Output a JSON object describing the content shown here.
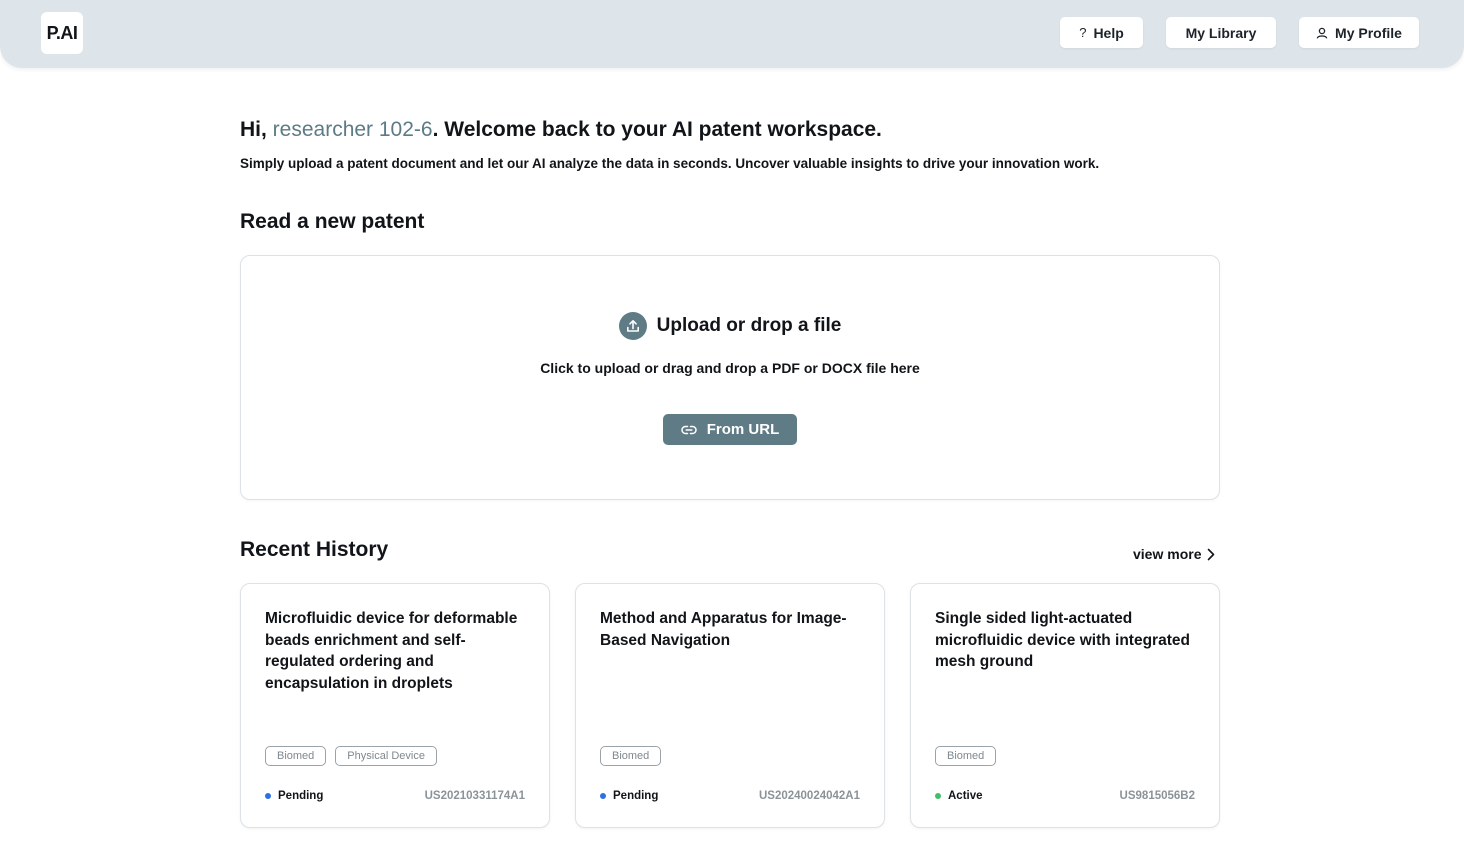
{
  "header": {
    "logo": "P.AI",
    "help_label": "Help",
    "library_label": "My Library",
    "profile_label": "My Profile"
  },
  "welcome": {
    "prefix": "Hi, ",
    "username": "researcher 102-6",
    "suffix": ". Welcome back to your AI patent workspace.",
    "subtitle": "Simply upload a patent document and let our AI analyze the data in seconds. Uncover valuable insights to drive your innovation work."
  },
  "read_section": {
    "title": "Read a new patent",
    "upload_title": "Upload or drop a file",
    "upload_desc": "Click to upload or drag and drop a PDF or DOCX file here",
    "url_button": "From URL"
  },
  "recent": {
    "title": "Recent History",
    "view_more": "view more",
    "cards": [
      {
        "title": "Microfluidic device for deformable beads enrichment and self-regulated ordering and encapsulation in droplets",
        "tags": [
          "Biomed",
          "Physical Device"
        ],
        "status": "Pending",
        "status_color": "#2f6fe0",
        "patent_number": "US20210331174A1"
      },
      {
        "title": "Method and Apparatus for Image-Based Navigation",
        "tags": [
          "Biomed"
        ],
        "status": "Pending",
        "status_color": "#2f6fe0",
        "patent_number": "US20240024042A1"
      },
      {
        "title": "Single sided light-actuated microfluidic device with integrated mesh ground",
        "tags": [
          "Biomed"
        ],
        "status": "Active",
        "status_color": "#3fbf6a",
        "patent_number": "US9815056B2"
      }
    ]
  },
  "colors": {
    "header_bg": "#dde5ea",
    "accent": "#5f7b86",
    "username": "#5d7b86"
  },
  "icons": {
    "help": "question-icon",
    "profile": "user-icon",
    "upload": "upload-icon",
    "url": "link-icon",
    "view_more": "chevron-right-icon"
  }
}
